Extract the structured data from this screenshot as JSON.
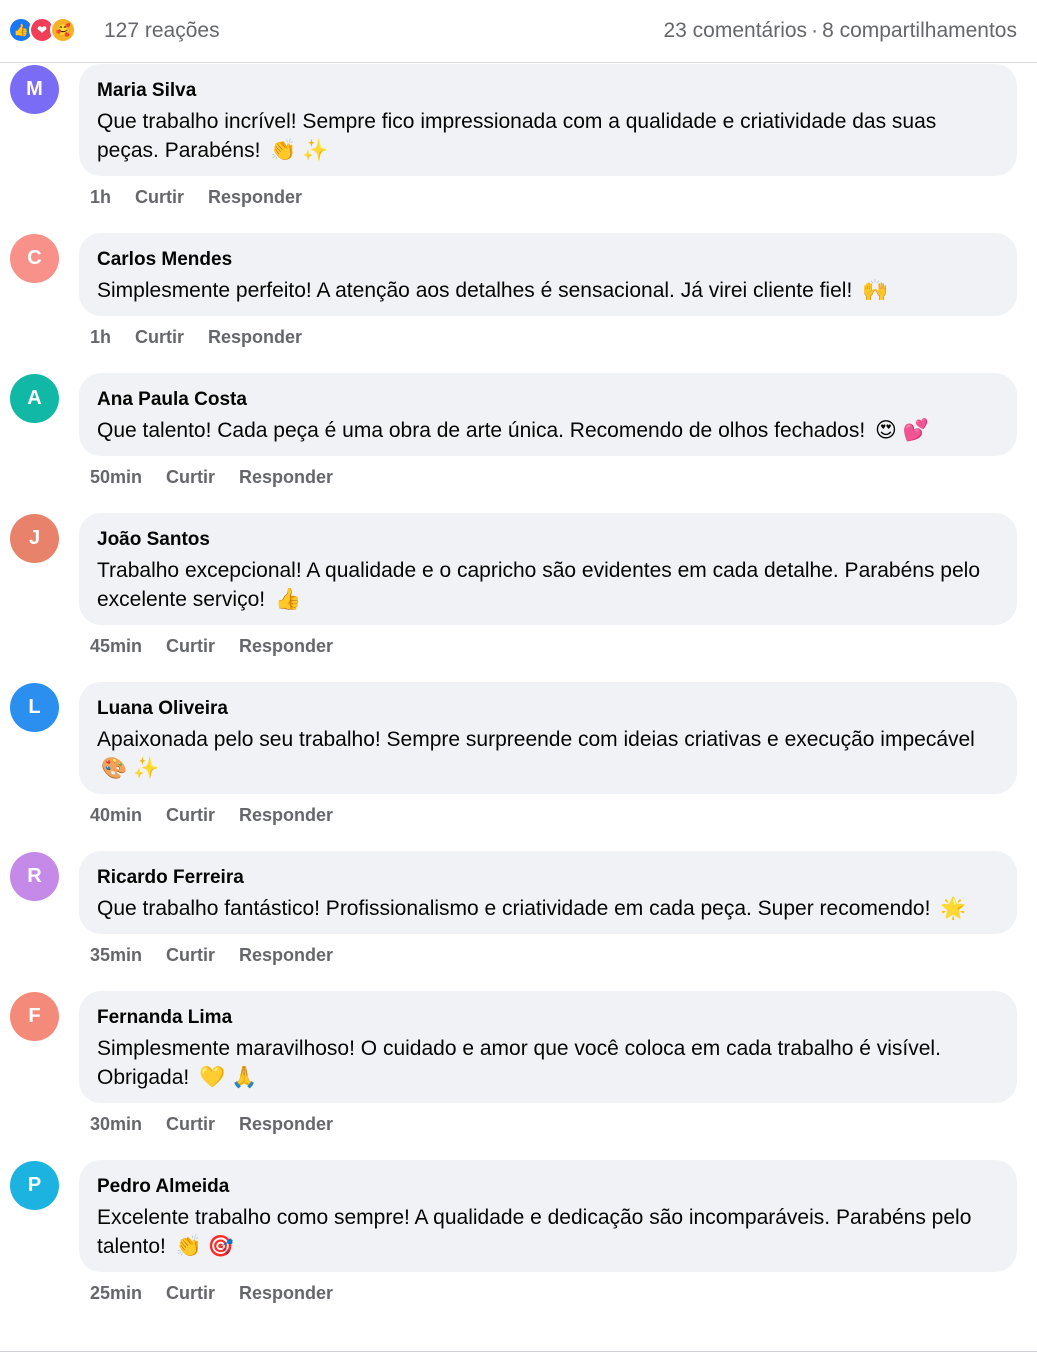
{
  "reactions": {
    "icons": [
      {
        "name": "like-reaction-icon",
        "glyph": "👍"
      },
      {
        "name": "love-reaction-icon",
        "glyph": "❤"
      },
      {
        "name": "care-reaction-icon",
        "glyph": "🥰"
      }
    ],
    "count_label": "127 reações",
    "comments_label": "23 comentários",
    "separator": "·",
    "shares_label": "8 compartilhamentos"
  },
  "comments": [
    {
      "initial": "M",
      "author": "Maria Silva",
      "text": "Que trabalho incrível! Sempre fico impressionada com a qualidade e criatividade das suas peças. Parabéns!",
      "emoji": "👏 ✨",
      "time": "1h",
      "like": "Curtir",
      "reply": "Responder",
      "avatar_color": "#7b6cf6"
    },
    {
      "initial": "C",
      "author": "Carlos Mendes",
      "text": "Simplesmente perfeito! A atenção aos detalhes é sensacional. Já virei cliente fiel!",
      "emoji": "🙌",
      "time": "1h",
      "like": "Curtir",
      "reply": "Responder",
      "avatar_color": "#f7918a"
    },
    {
      "initial": "A",
      "author": "Ana Paula Costa",
      "text": "Que talento! Cada peça é uma obra de arte única. Recomendo de olhos fechados!",
      "emoji": "😍 💕",
      "time": "50min",
      "like": "Curtir",
      "reply": "Responder",
      "avatar_color": "#12b8a6"
    },
    {
      "initial": "J",
      "author": "João Santos",
      "text": "Trabalho excepcional! A qualidade e o capricho são evidentes em cada detalhe. Parabéns pelo excelente serviço!",
      "emoji": "👍",
      "time": "45min",
      "like": "Curtir",
      "reply": "Responder",
      "avatar_color": "#e8826b"
    },
    {
      "initial": "L",
      "author": "Luana Oliveira",
      "text": "Apaixonada pelo seu trabalho! Sempre surpreende com ideias criativas e execução impecável",
      "emoji": "🎨 ✨",
      "time": "40min",
      "like": "Curtir",
      "reply": "Responder",
      "avatar_color": "#2b8ff0"
    },
    {
      "initial": "R",
      "author": "Ricardo Ferreira",
      "text": "Que trabalho fantástico! Profissionalismo e criatividade em cada peça. Super recomendo!",
      "emoji": "🌟",
      "time": "35min",
      "like": "Curtir",
      "reply": "Responder",
      "avatar_color": "#c58ae8"
    },
    {
      "initial": "F",
      "author": "Fernanda Lima",
      "text": "Simplesmente maravilhoso! O cuidado e amor que você coloca em cada trabalho é visível. Obrigada!",
      "emoji": "💛 🙏",
      "time": "30min",
      "like": "Curtir",
      "reply": "Responder",
      "avatar_color": "#f48a7a"
    },
    {
      "initial": "P",
      "author": "Pedro Almeida",
      "text": "Excelente trabalho como sempre! A qualidade e dedicação são incomparáveis. Parabéns pelo talento!",
      "emoji": "👏 🎯",
      "time": "25min",
      "like": "Curtir",
      "reply": "Responder",
      "avatar_color": "#1cb3e0"
    }
  ]
}
